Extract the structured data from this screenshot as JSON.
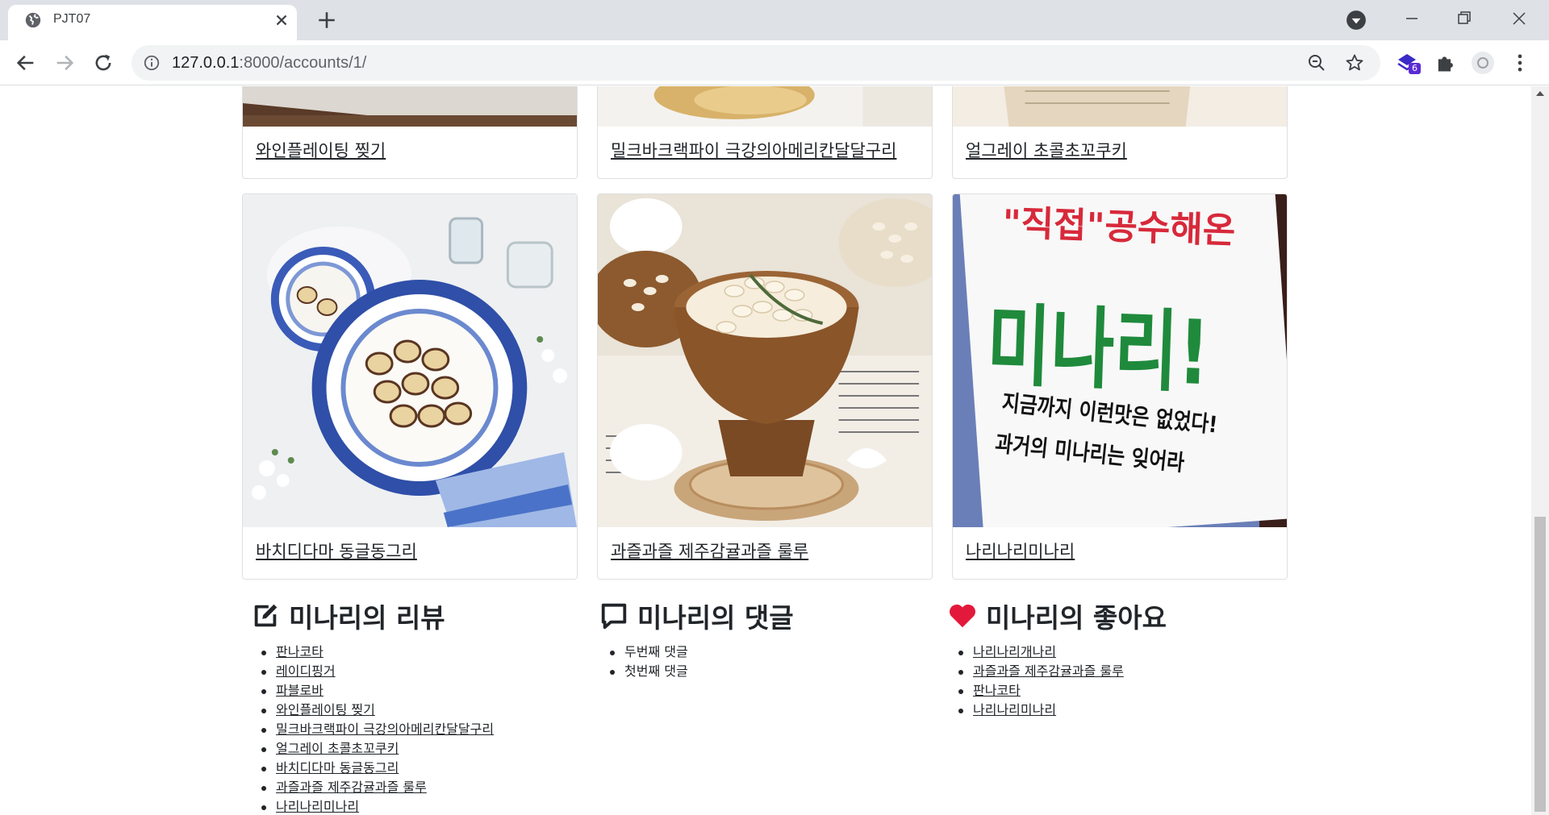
{
  "browser": {
    "tab_title": "PJT07",
    "url_host": "127.0.0.1",
    "url_path": ":8000/accounts/1/",
    "extension_badge": "6"
  },
  "colors": {
    "heart": "#e3193b",
    "text": "#212529",
    "badge": "#5b2bd6"
  },
  "cards_top": [
    {
      "title": "와인플레이팅 찢기"
    },
    {
      "title": "밀크바크랙파이 극강의아메리칸달달구리"
    },
    {
      "title": "얼그레이 초콜초꼬쿠키"
    }
  ],
  "cards": [
    {
      "title": "바치디다마 동글동그리"
    },
    {
      "title": "과즐과즐 제주감귤과즐 룰루"
    },
    {
      "title": "나리나리미나리",
      "sign": {
        "line1": "\"직접\"공수해온",
        "line2": "미나리!",
        "line3": "지금까지 이런맛은 없었다!",
        "line4": "과거의 미나리는 잊어라"
      }
    }
  ],
  "reviews": {
    "title": "미나리의 리뷰",
    "icon": "edit-icon",
    "items": [
      "판나코타",
      "레이디핑거",
      "파블로바",
      "와인플레이팅 찢기",
      "밀크바크랙파이 극강의아메리칸달달구리",
      "얼그레이 초콜초꼬쿠키",
      "바치디다마 동글동그리",
      "과즐과즐 제주감귤과즐 룰루",
      "나리나리미나리"
    ]
  },
  "comments": {
    "title": "미나리의 댓글",
    "icon": "comment-icon",
    "items": [
      "두번째 댓글",
      "첫번째 댓글"
    ]
  },
  "likes": {
    "title": "미나리의 좋아요",
    "icon": "heart-icon",
    "items": [
      "나리나리개나리",
      "과즐과즐 제주감귤과즐 룰루",
      "판나코타",
      "나리나리미나리"
    ]
  }
}
